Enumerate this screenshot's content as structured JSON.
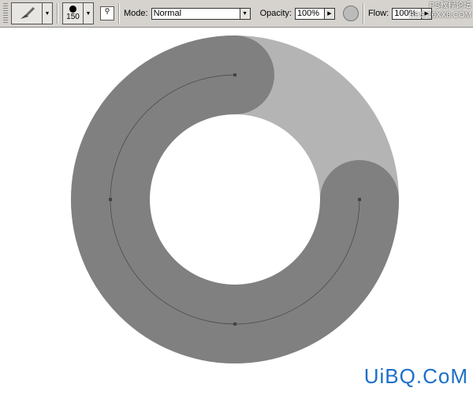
{
  "toolbar": {
    "brush_size": "150",
    "mode_label": "Mode:",
    "mode_value": "Normal",
    "opacity_label": "Opacity:",
    "opacity_value": "100%",
    "flow_label": "Flow:",
    "flow_value": "100%"
  },
  "canvas": {
    "ring_color": "#b4b4b4",
    "stroke_color": "#808080",
    "path_color": "#444444"
  },
  "watermark": {
    "top_line1": "PS教程论坛",
    "top_line2": "BBS.16XX8.COM",
    "bottom": "UiBQ.CoM"
  }
}
